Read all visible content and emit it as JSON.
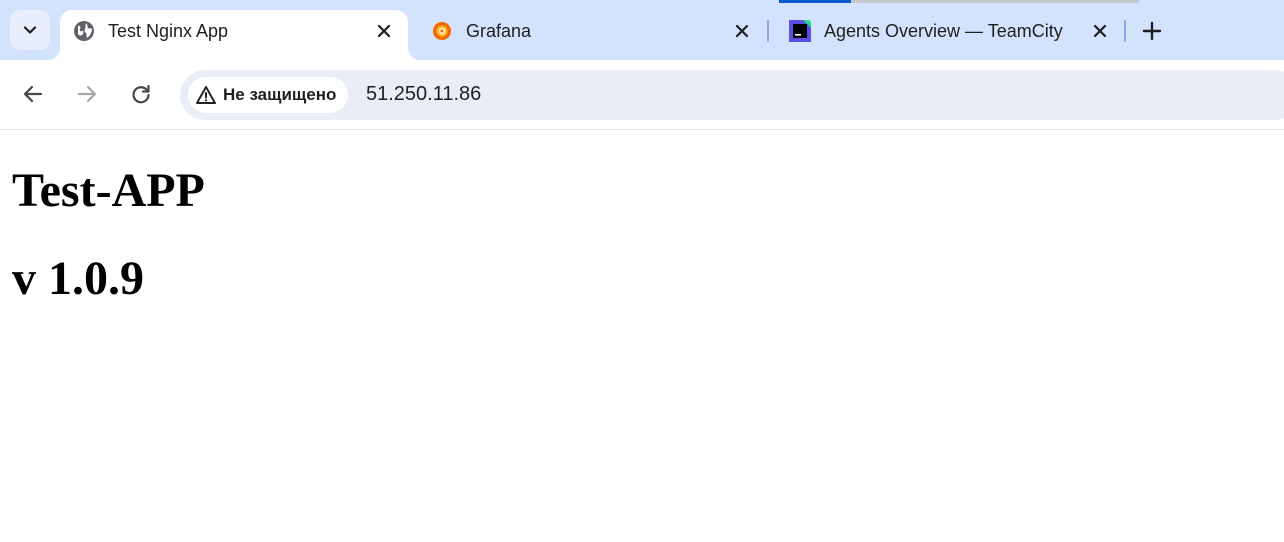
{
  "tabs": [
    {
      "title": "Test Nginx App",
      "icon": "globe-icon",
      "active": true
    },
    {
      "title": "Grafana",
      "icon": "grafana-icon",
      "active": false
    },
    {
      "title": "Agents Overview — TeamCity",
      "icon": "teamcity-icon",
      "active": false
    }
  ],
  "toolbar": {
    "security_label": "Не защищено",
    "url": "51.250.11.86"
  },
  "page": {
    "title": "Test-APP",
    "version": "v 1.0.9"
  },
  "colors": {
    "tabstrip_bg": "#d3e3fd",
    "omnibox_bg": "#e9eef6",
    "loading_accent": "#0b57d0"
  }
}
